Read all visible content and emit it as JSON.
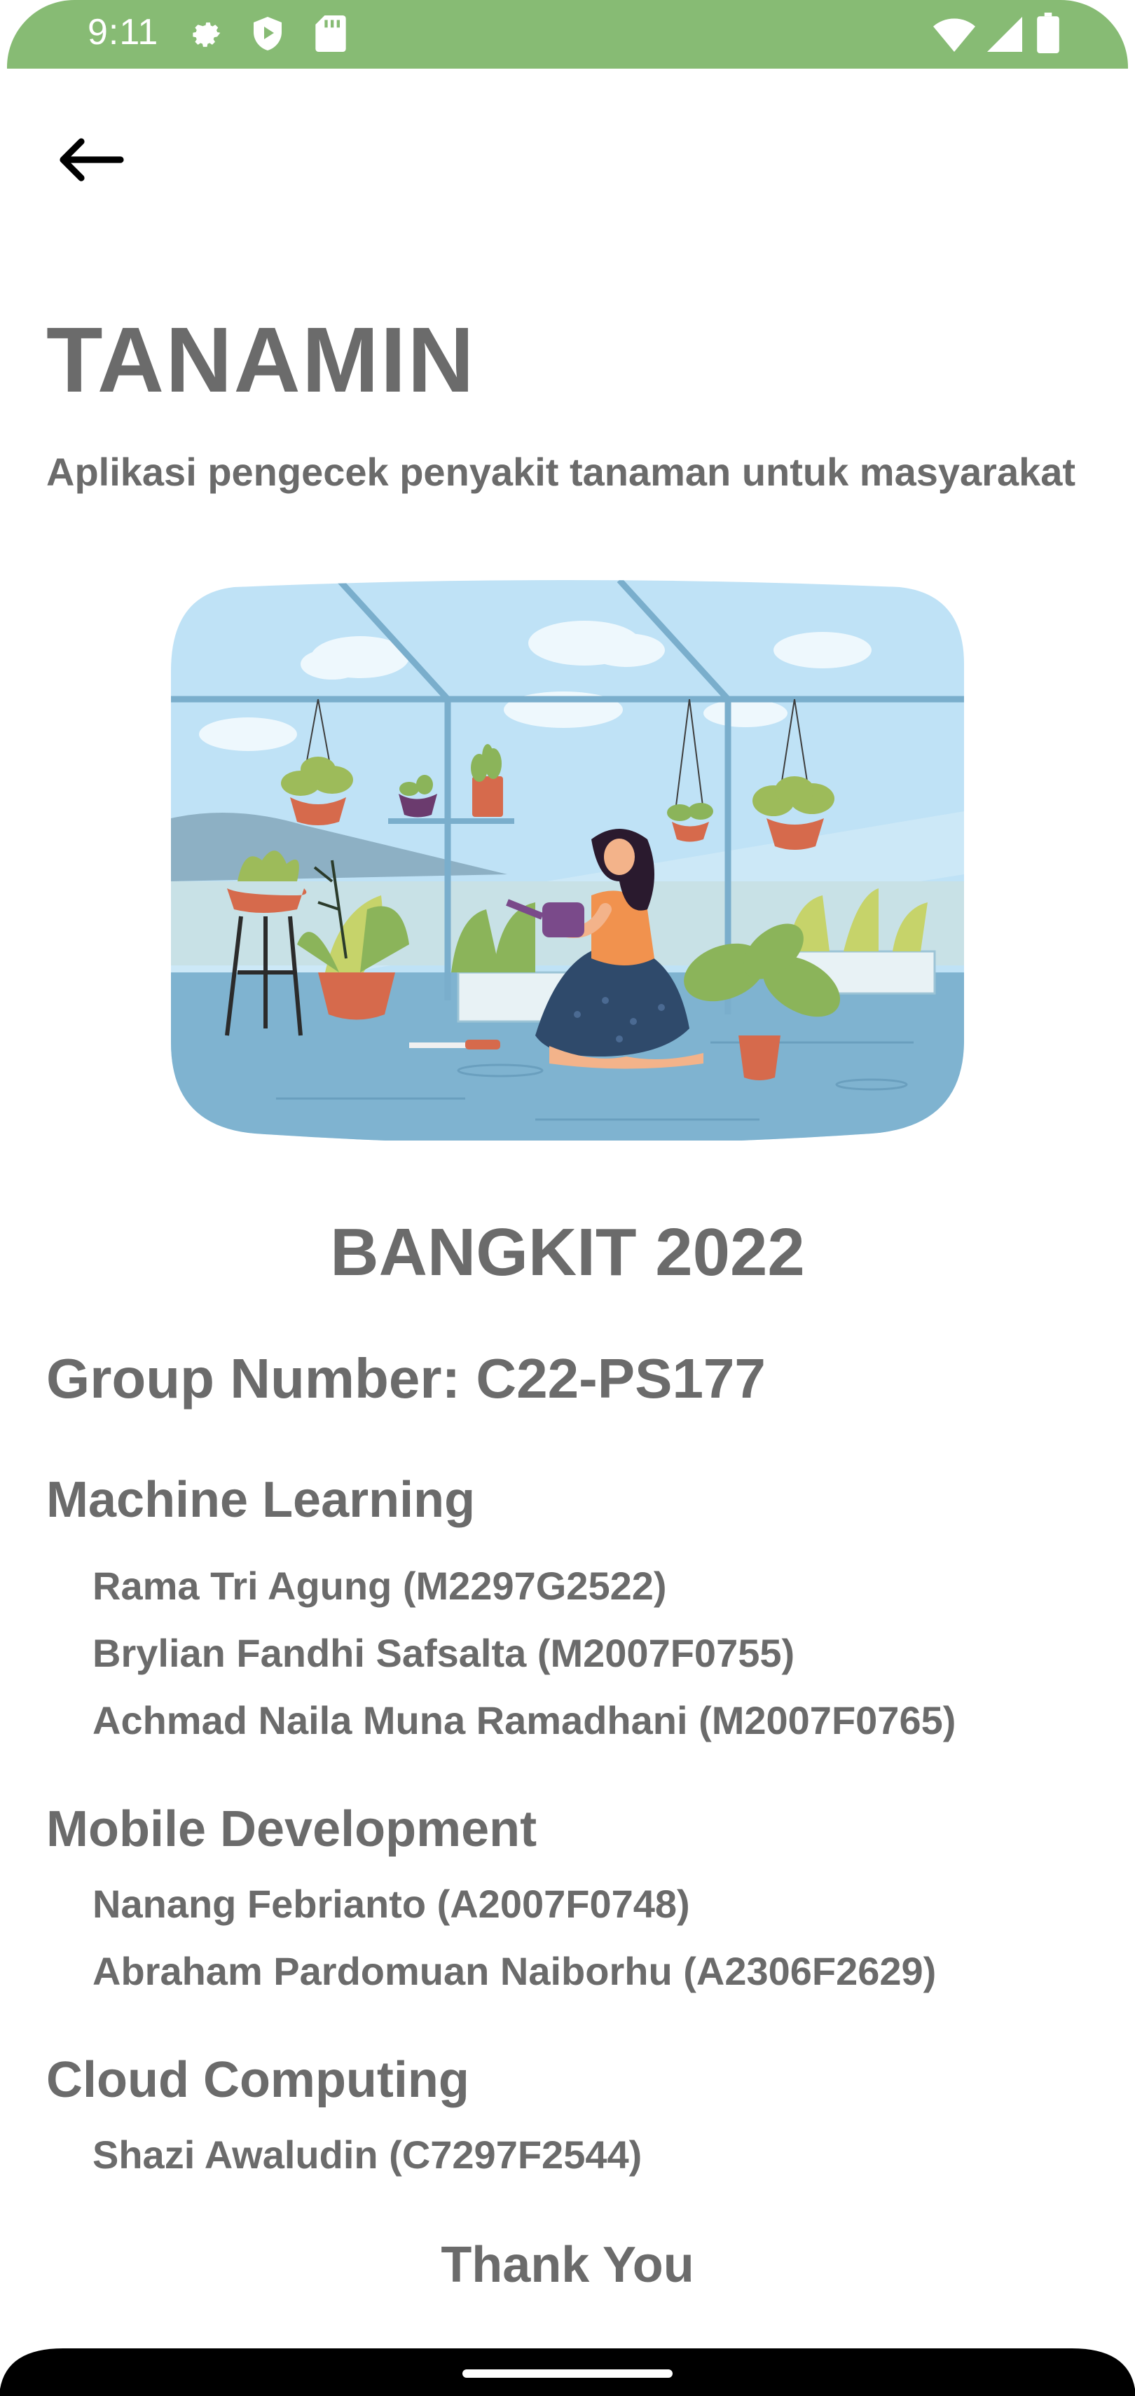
{
  "status_bar": {
    "time": "9:11",
    "icons": [
      "gear-icon",
      "play-protect-icon",
      "sd-card-icon",
      "wifi-icon",
      "signal-icon",
      "battery-icon"
    ],
    "background_color": "#87bb74"
  },
  "header": {
    "back_icon": "arrow-left-icon"
  },
  "app": {
    "title": "TANAMIN",
    "subtitle": "Aplikasi pengecek penyakit tanaman untuk masyarakat"
  },
  "illustration": {
    "description_icon": "greenhouse-illustration"
  },
  "event": {
    "title": "BANGKIT 2022"
  },
  "group": {
    "number_text": "Group Number: C22-PS177"
  },
  "sections": [
    {
      "title": "Machine Learning",
      "members": [
        "Rama Tri Agung (M2297G2522)",
        "Brylian Fandhi Safsalta (M2007F0755)",
        "Achmad Naila Muna Ramadhani (M2007F0765)"
      ]
    },
    {
      "title": "Mobile Development",
      "members": [
        "Nanang Febrianto (A2007F0748)",
        "Abraham Pardomuan Naiborhu (A2306F2629)"
      ]
    },
    {
      "title": "Cloud Computing",
      "members": [
        "Shazi Awaludin (C7297F2544)"
      ]
    }
  ],
  "footer": {
    "thank_you": "Thank You"
  },
  "colors": {
    "text": "#6b6b6b",
    "accent": "#87bb74"
  }
}
